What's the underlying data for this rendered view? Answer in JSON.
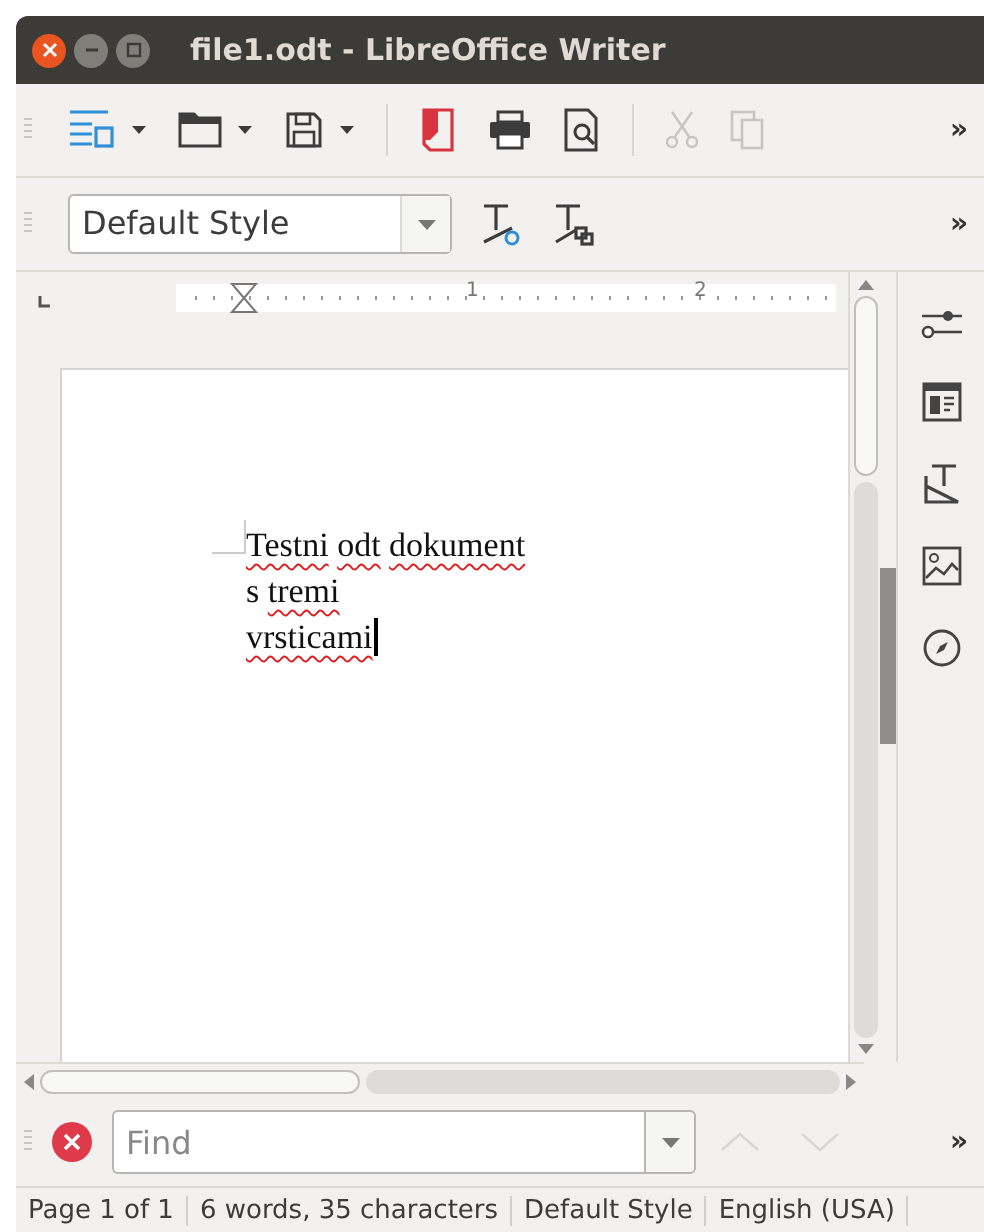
{
  "window": {
    "title": "file1.odt - LibreOffice Writer"
  },
  "toolbar": {
    "items": [
      {
        "kind": "new",
        "dropdown": true,
        "disabled": false
      },
      {
        "kind": "open",
        "dropdown": true,
        "disabled": false
      },
      {
        "kind": "save",
        "dropdown": true,
        "disabled": false
      },
      {
        "kind": "separator"
      },
      {
        "kind": "pdf",
        "dropdown": false,
        "disabled": false
      },
      {
        "kind": "print",
        "dropdown": false,
        "disabled": false
      },
      {
        "kind": "preview",
        "dropdown": false,
        "disabled": false
      },
      {
        "kind": "separator"
      },
      {
        "kind": "cut",
        "dropdown": false,
        "disabled": true
      },
      {
        "kind": "copy",
        "dropdown": false,
        "disabled": true
      }
    ],
    "overflow": "»"
  },
  "format_toolbar": {
    "style_value": "Default Style",
    "items": [
      {
        "kind": "update-style"
      },
      {
        "kind": "new-style"
      }
    ],
    "overflow": "»"
  },
  "ruler": {
    "labels": [
      "1",
      "2"
    ]
  },
  "document": {
    "lines": [
      {
        "cursor": false,
        "words": [
          {
            "text": "Testni",
            "misspelled": true
          },
          {
            "text": "odt",
            "misspelled": true
          },
          {
            "text": "dokument",
            "misspelled": true
          }
        ]
      },
      {
        "cursor": false,
        "words": [
          {
            "text": "s",
            "misspelled": false
          },
          {
            "text": "tremi",
            "misspelled": true
          }
        ]
      },
      {
        "cursor": true,
        "words": [
          {
            "text": "vrsticami",
            "misspelled": true
          }
        ]
      }
    ]
  },
  "sidebar": {
    "items": [
      {
        "kind": "properties"
      },
      {
        "kind": "page"
      },
      {
        "kind": "styles"
      },
      {
        "kind": "gallery"
      },
      {
        "kind": "navigator"
      }
    ]
  },
  "find_bar": {
    "placeholder": "Find",
    "previous_disabled": true,
    "next_disabled": true,
    "overflow": "»"
  },
  "status_bar": [
    "Page 1 of 1",
    "6 words, 35 characters",
    "Default Style",
    "English (USA)"
  ]
}
